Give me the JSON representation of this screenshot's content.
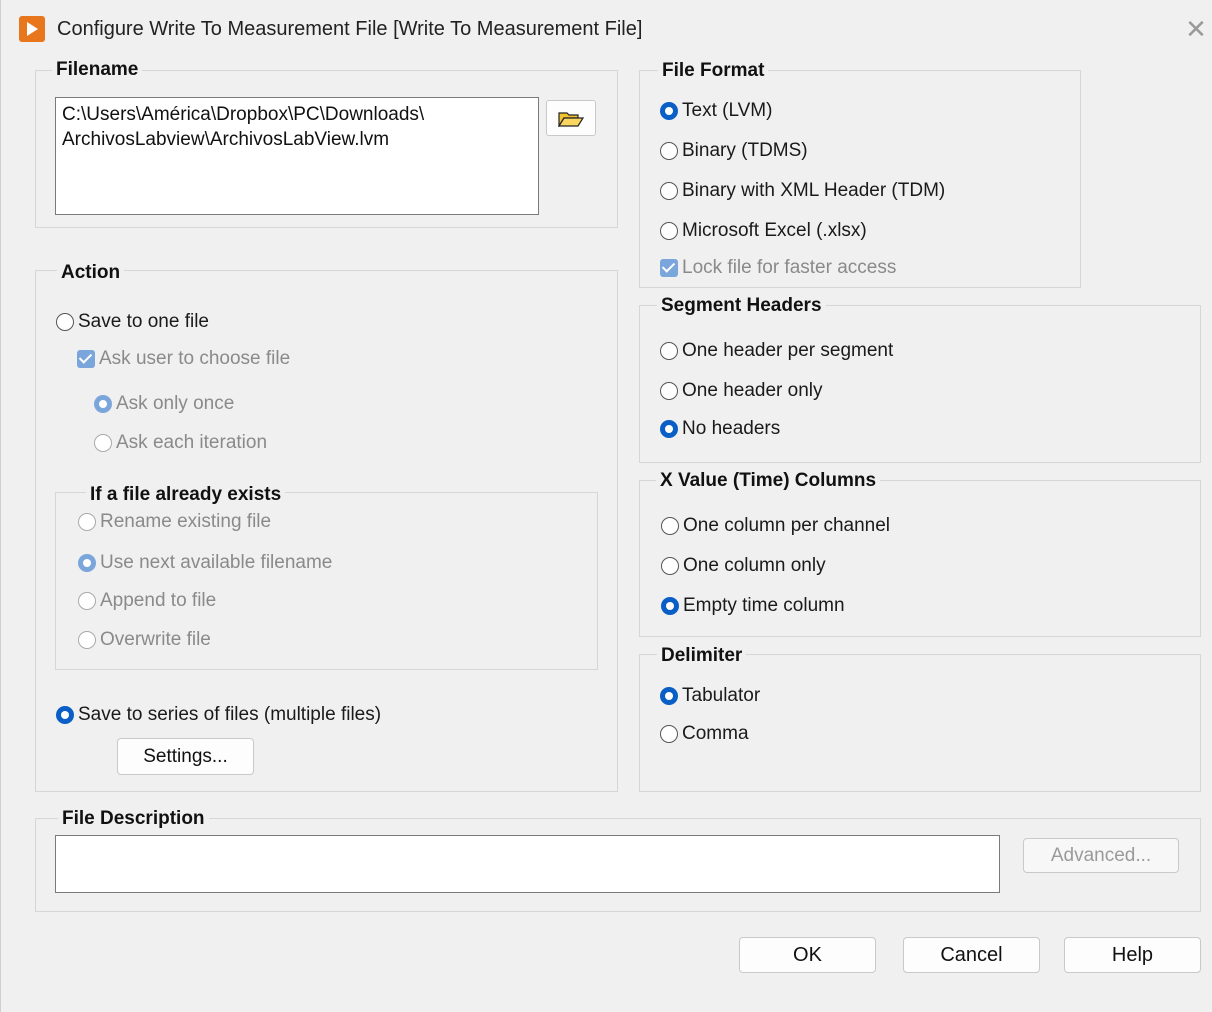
{
  "window": {
    "title": "Configure Write To Measurement File [Write To Measurement File]",
    "close_symbol": "✕"
  },
  "filename": {
    "label": "Filename",
    "path": "C:\\Users\\América\\Dropbox\\PC\\Downloads\\\nArchivosLabview\\ArchivosLabView.lvm"
  },
  "action": {
    "label": "Action",
    "save_one": "Save to one file",
    "ask_user": "Ask user to choose file",
    "ask_once": "Ask only once",
    "ask_each": "Ask each iteration",
    "exists_label": "If a file already exists",
    "rename": "Rename existing file",
    "next_available": "Use next available filename",
    "append": "Append to file",
    "overwrite": "Overwrite file",
    "save_series": "Save to series of files (multiple files)",
    "settings_button": "Settings..."
  },
  "file_format": {
    "label": "File Format",
    "text_lvm": "Text (LVM)",
    "binary_tdms": "Binary (TDMS)",
    "binary_xml": "Binary with XML Header (TDM)",
    "excel": "Microsoft Excel (.xlsx)",
    "lock_file": "Lock file for faster access"
  },
  "segment_headers": {
    "label": "Segment Headers",
    "per_segment": "One header per segment",
    "only": "One header only",
    "none": "No headers"
  },
  "x_columns": {
    "label": "X Value (Time) Columns",
    "per_channel": "One column per channel",
    "only": "One column only",
    "empty": "Empty time column"
  },
  "delimiter": {
    "label": "Delimiter",
    "tab": "Tabulator",
    "comma": "Comma"
  },
  "description": {
    "label": "File Description",
    "value": "",
    "advanced_button": "Advanced..."
  },
  "buttons": {
    "ok": "OK",
    "cancel": "Cancel",
    "help": "Help"
  },
  "colors": {
    "accent": "#0a5fc6",
    "app_icon": "#e8761c",
    "dialog_bg": "#f0f0f0"
  }
}
